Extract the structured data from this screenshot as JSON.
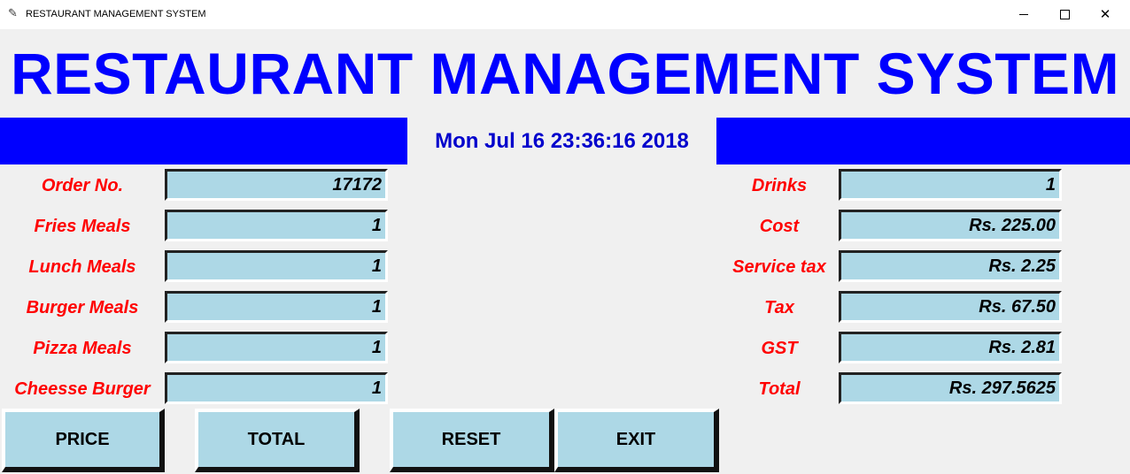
{
  "window": {
    "title": "RESTAURANT MANAGEMENT SYSTEM",
    "icon": "feather-icon",
    "minimize_icon": "minimize-icon",
    "maximize_icon": "maximize-icon",
    "close_icon": "close-icon",
    "close_glyph": "✕"
  },
  "heading": "RESTAURANT MANAGEMENT SYSTEM",
  "datetime": "Mon Jul 16 23:36:16 2018",
  "colors": {
    "heading": "#0000ff",
    "banner": "#0000ff",
    "label": "#ff0000",
    "field_bg": "#add8e6",
    "background": "#f0f0f0"
  },
  "left_fields": [
    {
      "label": "Order No.",
      "value": "17172"
    },
    {
      "label": "Fries Meals",
      "value": "1"
    },
    {
      "label": "Lunch Meals",
      "value": "1"
    },
    {
      "label": "Burger Meals",
      "value": "1"
    },
    {
      "label": "Pizza Meals",
      "value": "1"
    },
    {
      "label": "Cheesse Burger",
      "value": "1"
    }
  ],
  "right_fields": [
    {
      "label": "Drinks",
      "value": "1"
    },
    {
      "label": "Cost",
      "value": "Rs. 225.00"
    },
    {
      "label": "Service tax",
      "value": "Rs. 2.25"
    },
    {
      "label": "Tax",
      "value": "Rs. 67.50"
    },
    {
      "label": "GST",
      "value": "Rs. 2.81"
    },
    {
      "label": "Total",
      "value": "Rs. 297.5625"
    }
  ],
  "buttons": {
    "price": "PRICE",
    "total": "TOTAL",
    "reset": "RESET",
    "exit": "EXIT"
  }
}
